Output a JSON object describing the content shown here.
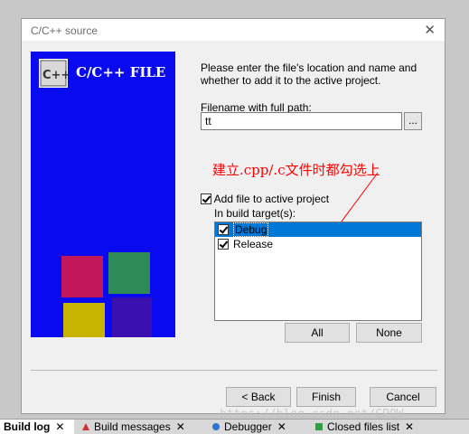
{
  "dialog": {
    "title": "C/C++ source",
    "close_glyph": "✕",
    "banner_title": "C/C++ FILE",
    "logo_text": "C++",
    "intro_text": "Please enter the file's location and name and whether to add it to the active project.",
    "filename_label": "Filename with full path:",
    "filename_value": "tt",
    "browse_label": "...",
    "annotation": "建立.cpp/.c文件时都勾选上",
    "add_to_project_label": "Add file to active project",
    "build_targets_label": "In build target(s):",
    "build_targets": [
      {
        "label": "Debug",
        "checked": true,
        "selected": true
      },
      {
        "label": "Release",
        "checked": true,
        "selected": false
      }
    ],
    "all_label": "All",
    "none_label": "None",
    "back_label": "< Back",
    "finish_label": "Finish",
    "cancel_label": "Cancel"
  },
  "tabs": [
    {
      "label": "Build log",
      "active": true
    },
    {
      "label": "Build messages",
      "active": false
    },
    {
      "label": "Debugger",
      "active": false
    },
    {
      "label": "Closed files list",
      "active": false
    }
  ],
  "tab_close_glyph": "✕",
  "watermark": "https://blog.csdn.net/CPQW",
  "colors": {
    "banner": "#0a0af0",
    "selection": "#0078d7",
    "annotation": "#ff0000"
  }
}
